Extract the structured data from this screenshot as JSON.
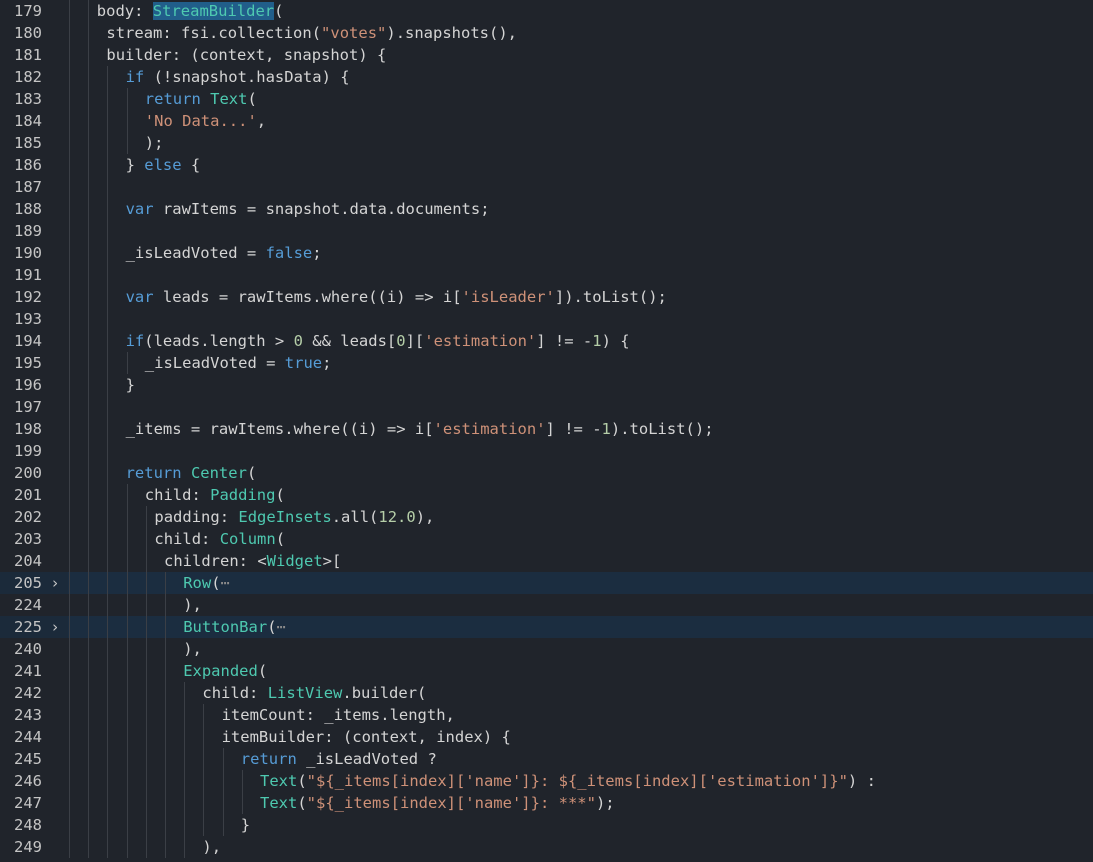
{
  "editor": {
    "lines": [
      {
        "number": "179",
        "indent": 3,
        "tokens": [
          {
            "t": "body: ",
            "c": "id"
          },
          {
            "t": "StreamBuilder",
            "c": "type",
            "sel": true
          },
          {
            "t": "(",
            "c": "punc"
          }
        ]
      },
      {
        "number": "180",
        "indent": 4,
        "tokens": [
          {
            "t": "stream: fsi.collection(",
            "c": "id"
          },
          {
            "t": "\"votes\"",
            "c": "str"
          },
          {
            "t": ").snapshots(),",
            "c": "id"
          }
        ]
      },
      {
        "number": "181",
        "indent": 4,
        "tokens": [
          {
            "t": "builder: (context, snapshot) {",
            "c": "id"
          }
        ]
      },
      {
        "number": "182",
        "indent": 6,
        "tokens": [
          {
            "t": "if",
            "c": "kw"
          },
          {
            "t": " (!snapshot.hasData) {",
            "c": "id"
          }
        ]
      },
      {
        "number": "183",
        "indent": 8,
        "tokens": [
          {
            "t": "return",
            "c": "kw"
          },
          {
            "t": " ",
            "c": "id"
          },
          {
            "t": "Text",
            "c": "type"
          },
          {
            "t": "(",
            "c": "punc"
          }
        ]
      },
      {
        "number": "184",
        "indent": 8,
        "tokens": [
          {
            "t": "'No Data...'",
            "c": "str"
          },
          {
            "t": ",",
            "c": "punc"
          }
        ]
      },
      {
        "number": "185",
        "indent": 8,
        "tokens": [
          {
            "t": ");",
            "c": "punc"
          }
        ]
      },
      {
        "number": "186",
        "indent": 6,
        "tokens": [
          {
            "t": "} ",
            "c": "id"
          },
          {
            "t": "else",
            "c": "kw"
          },
          {
            "t": " {",
            "c": "id"
          }
        ]
      },
      {
        "number": "187",
        "indent": 6,
        "tokens": []
      },
      {
        "number": "188",
        "indent": 6,
        "tokens": [
          {
            "t": "var",
            "c": "kw"
          },
          {
            "t": " rawItems = snapshot.data.documents;",
            "c": "id"
          }
        ]
      },
      {
        "number": "189",
        "indent": 6,
        "tokens": []
      },
      {
        "number": "190",
        "indent": 6,
        "tokens": [
          {
            "t": "_isLeadVoted = ",
            "c": "id"
          },
          {
            "t": "false",
            "c": "kw"
          },
          {
            "t": ";",
            "c": "punc"
          }
        ]
      },
      {
        "number": "191",
        "indent": 6,
        "tokens": []
      },
      {
        "number": "192",
        "indent": 6,
        "tokens": [
          {
            "t": "var",
            "c": "kw"
          },
          {
            "t": " leads = rawItems.where((i) => i[",
            "c": "id"
          },
          {
            "t": "'isLeader'",
            "c": "str"
          },
          {
            "t": "]).toList();",
            "c": "id"
          }
        ]
      },
      {
        "number": "193",
        "indent": 6,
        "tokens": []
      },
      {
        "number": "194",
        "indent": 6,
        "tokens": [
          {
            "t": "if",
            "c": "kw"
          },
          {
            "t": "(leads.length > ",
            "c": "id"
          },
          {
            "t": "0",
            "c": "num"
          },
          {
            "t": " && leads[",
            "c": "id"
          },
          {
            "t": "0",
            "c": "num"
          },
          {
            "t": "][",
            "c": "id"
          },
          {
            "t": "'estimation'",
            "c": "str"
          },
          {
            "t": "] != -",
            "c": "id"
          },
          {
            "t": "1",
            "c": "num"
          },
          {
            "t": ") {",
            "c": "id"
          }
        ]
      },
      {
        "number": "195",
        "indent": 8,
        "tokens": [
          {
            "t": "_isLeadVoted = ",
            "c": "id"
          },
          {
            "t": "true",
            "c": "kw"
          },
          {
            "t": ";",
            "c": "punc"
          }
        ]
      },
      {
        "number": "196",
        "indent": 6,
        "tokens": [
          {
            "t": "}",
            "c": "punc"
          }
        ]
      },
      {
        "number": "197",
        "indent": 6,
        "tokens": []
      },
      {
        "number": "198",
        "indent": 6,
        "tokens": [
          {
            "t": "_items = rawItems.where((i) => i[",
            "c": "id"
          },
          {
            "t": "'estimation'",
            "c": "str"
          },
          {
            "t": "] != -",
            "c": "id"
          },
          {
            "t": "1",
            "c": "num"
          },
          {
            "t": ").toList();",
            "c": "id"
          }
        ]
      },
      {
        "number": "199",
        "indent": 6,
        "tokens": []
      },
      {
        "number": "200",
        "indent": 6,
        "tokens": [
          {
            "t": "return",
            "c": "kw"
          },
          {
            "t": " ",
            "c": "id"
          },
          {
            "t": "Center",
            "c": "type"
          },
          {
            "t": "(",
            "c": "punc"
          }
        ]
      },
      {
        "number": "201",
        "indent": 8,
        "tokens": [
          {
            "t": "child: ",
            "c": "id"
          },
          {
            "t": "Padding",
            "c": "type"
          },
          {
            "t": "(",
            "c": "punc"
          }
        ]
      },
      {
        "number": "202",
        "indent": 9,
        "tokens": [
          {
            "t": "padding: ",
            "c": "id"
          },
          {
            "t": "EdgeInsets",
            "c": "type"
          },
          {
            "t": ".all(",
            "c": "id"
          },
          {
            "t": "12.0",
            "c": "num"
          },
          {
            "t": "),",
            "c": "punc"
          }
        ]
      },
      {
        "number": "203",
        "indent": 9,
        "tokens": [
          {
            "t": "child: ",
            "c": "id"
          },
          {
            "t": "Column",
            "c": "type"
          },
          {
            "t": "(",
            "c": "punc"
          }
        ]
      },
      {
        "number": "204",
        "indent": 10,
        "tokens": [
          {
            "t": "children: <",
            "c": "id"
          },
          {
            "t": "Widget",
            "c": "type"
          },
          {
            "t": ">[",
            "c": "punc"
          }
        ]
      },
      {
        "number": "205",
        "indent": 12,
        "fold": "›",
        "highlight": true,
        "tokens": [
          {
            "t": "Row",
            "c": "type"
          },
          {
            "t": "(",
            "c": "punc"
          },
          {
            "t": "⋯",
            "c": "dots"
          }
        ]
      },
      {
        "number": "224",
        "indent": 12,
        "tokens": [
          {
            "t": "),",
            "c": "punc"
          }
        ]
      },
      {
        "number": "225",
        "indent": 12,
        "fold": "›",
        "highlight": true,
        "tokens": [
          {
            "t": "ButtonBar",
            "c": "type"
          },
          {
            "t": "(",
            "c": "punc"
          },
          {
            "t": "⋯",
            "c": "dots"
          }
        ]
      },
      {
        "number": "240",
        "indent": 12,
        "tokens": [
          {
            "t": "),",
            "c": "punc"
          }
        ]
      },
      {
        "number": "241",
        "indent": 12,
        "tokens": [
          {
            "t": "Expanded",
            "c": "type"
          },
          {
            "t": "(",
            "c": "punc"
          }
        ]
      },
      {
        "number": "242",
        "indent": 14,
        "tokens": [
          {
            "t": "child: ",
            "c": "id"
          },
          {
            "t": "ListView",
            "c": "type"
          },
          {
            "t": ".builder(",
            "c": "id"
          }
        ]
      },
      {
        "number": "243",
        "indent": 16,
        "tokens": [
          {
            "t": "itemCount: _items.length,",
            "c": "id"
          }
        ]
      },
      {
        "number": "244",
        "indent": 16,
        "tokens": [
          {
            "t": "itemBuilder: (context, index) {",
            "c": "id"
          }
        ]
      },
      {
        "number": "245",
        "indent": 18,
        "tokens": [
          {
            "t": "return",
            "c": "kw"
          },
          {
            "t": " _isLeadVoted ?",
            "c": "id"
          }
        ]
      },
      {
        "number": "246",
        "indent": 20,
        "tokens": [
          {
            "t": "Text",
            "c": "type"
          },
          {
            "t": "(",
            "c": "punc"
          },
          {
            "t": "\"${_items[index]['name']}: ${_items[index]['estimation']}\"",
            "c": "str"
          },
          {
            "t": ") :",
            "c": "punc"
          }
        ]
      },
      {
        "number": "247",
        "indent": 20,
        "tokens": [
          {
            "t": "Text",
            "c": "type"
          },
          {
            "t": "(",
            "c": "punc"
          },
          {
            "t": "\"${_items[index]['name']}: ***\"",
            "c": "str"
          },
          {
            "t": ");",
            "c": "punc"
          }
        ]
      },
      {
        "number": "248",
        "indent": 18,
        "tokens": [
          {
            "t": "}",
            "c": "punc"
          }
        ]
      },
      {
        "number": "249",
        "indent": 14,
        "tokens": [
          {
            "t": "),",
            "c": "punc"
          }
        ]
      }
    ]
  }
}
